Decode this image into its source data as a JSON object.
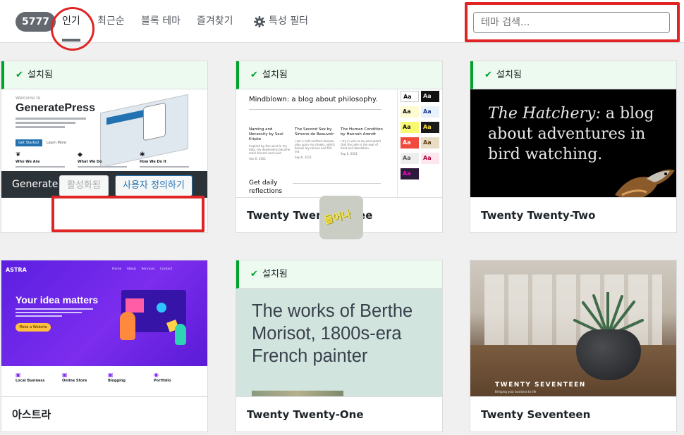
{
  "filter_bar": {
    "theme_count": "5777",
    "tabs": [
      {
        "label": "인기",
        "current": true
      },
      {
        "label": "최근순",
        "current": false
      },
      {
        "label": "블록 테마",
        "current": false
      },
      {
        "label": "즐겨찾기",
        "current": false
      }
    ],
    "feature_filter": {
      "label": "특성 필터",
      "icon": "gear-icon"
    },
    "search": {
      "placeholder": "테마 검색..."
    }
  },
  "colors": {
    "installed_bar_bg": "#edfaef",
    "installed_accent": "#00a32a",
    "annotation_red": "#e02424",
    "link_blue": "#2271b1"
  },
  "installed_label": "설치됨",
  "themes": [
    {
      "name": "GeneratePress",
      "installed": true,
      "active_overlay": {
        "name_short": "Generate",
        "activated_button": "활성화됨",
        "customize_button": "사용자 정의하기"
      },
      "preview": {
        "welcome": "Welcome to",
        "brand": "GeneratePress",
        "primary_button": "Get Started",
        "secondary_link": "Learn More",
        "features": [
          "Who We Are",
          "What We Do",
          "How We Do It"
        ]
      }
    },
    {
      "name": "Twenty Twenty-Three",
      "installed": true,
      "preview": {
        "title": "Mindblown: a blog about philosophy.",
        "posts": [
          {
            "title": "Naming and Necessity by Saul Kripke",
            "date": "Sep 6, 2021"
          },
          {
            "title": "The Second Sex by Simone de Beauvoir",
            "date": "Sep 6, 2021"
          },
          {
            "title": "The Human Condition by Hannah Arendt",
            "date": "Sep 6, 2021"
          }
        ],
        "newsletter": "Get daily reflections",
        "swatch_label": "Aa"
      },
      "sticker_text": "들어나"
    },
    {
      "name": "Twenty Twenty-Two",
      "installed": true,
      "preview": {
        "title_italic": "The Hatchery:",
        "title_rest": " a blog about adventures in bird watching."
      }
    },
    {
      "name": "아스트라",
      "installed": false,
      "preview": {
        "logo": "ASTRA",
        "nav": "Home About Services Contact",
        "headline": "Your idea matters",
        "cta": "Make a Website",
        "categories": [
          "Local Business",
          "Online Store",
          "Blogging",
          "Portfolio"
        ]
      }
    },
    {
      "name": "Twenty Twenty-One",
      "installed": true,
      "preview": {
        "title": "The works of Berthe Morisot, 1800s-era French painter"
      }
    },
    {
      "name": "Twenty Seventeen",
      "installed": false,
      "preview": {
        "logo": "TWENTY SEVENTEEN",
        "tagline": "Bringing your business to life"
      }
    }
  ]
}
